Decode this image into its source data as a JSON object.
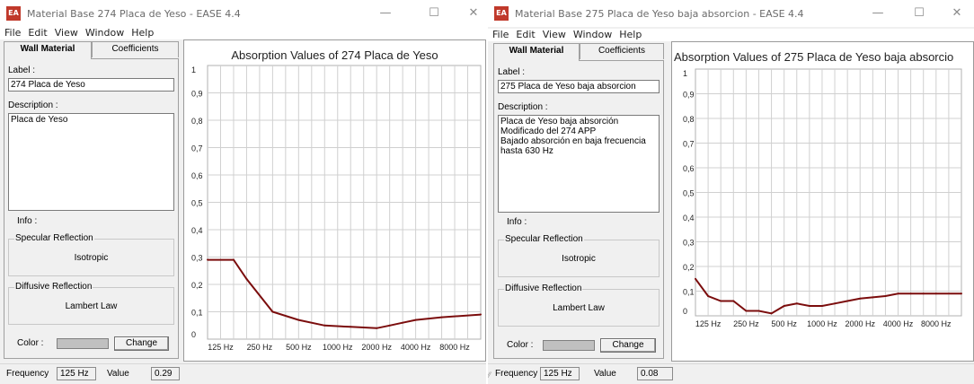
{
  "windows": [
    {
      "title": "Material Base 274 Placa de Yeso - EASE 4.4",
      "icon": "ease-app-icon",
      "menu": [
        "File",
        "Edit",
        "View",
        "Window",
        "Help"
      ],
      "tabs": {
        "active": "Wall Material",
        "inactive": "Coefficients"
      },
      "label_caption": "Label :",
      "label_value": "274 Placa de Yeso",
      "description_caption": "Description :",
      "description_value": "Placa de Yeso",
      "info_caption": "Info :",
      "specular_caption": "Specular Reflection",
      "specular_value": "Isotropic",
      "diffusive_caption": "Diffusive Reflection",
      "diffusive_value": "Lambert Law",
      "color_caption": "Color :",
      "change_label": "Change",
      "status": {
        "frequency_caption": "Frequency",
        "frequency_value": "125 Hz",
        "value_caption": "Value",
        "value": "0.29"
      },
      "chart_data": {
        "type": "line",
        "title": "Absorption Values of 274 Placa de Yeso",
        "xlabel": "",
        "ylabel": "",
        "x_tick_labels": [
          "125 Hz",
          "250 Hz",
          "500 Hz",
          "1000 Hz",
          "2000 Hz",
          "4000 Hz",
          "8000 Hz"
        ],
        "y_tick_labels": [
          "0",
          "0,1",
          "0,2",
          "0,3",
          "0,4",
          "0,5",
          "0,6",
          "0,7",
          "0,8",
          "0,9",
          "1"
        ],
        "ylim": [
          0,
          1
        ],
        "grid": true,
        "line_color": "#7b0d0d",
        "x_third_octave": [
          0,
          2,
          3,
          5,
          7,
          9,
          11,
          13,
          14,
          15,
          16,
          18,
          21
        ],
        "values": [
          0.29,
          0.29,
          0.22,
          0.1,
          0.07,
          0.05,
          0.045,
          0.04,
          0.05,
          0.06,
          0.07,
          0.08,
          0.09
        ],
        "end_value": 0.09
      }
    },
    {
      "title": "Material Base 275 Placa de Yeso baja absorcion - EASE 4.4",
      "icon": "ease-app-icon",
      "menu": [
        "File",
        "Edit",
        "View",
        "Window",
        "Help"
      ],
      "tabs": {
        "active": "Wall Material",
        "inactive": "Coefficients"
      },
      "label_caption": "Label :",
      "label_value": "275 Placa de Yeso baja absorcion",
      "description_caption": "Description :",
      "description_value": "Placa de Yeso baja absorción\nModificado del 274 APP\nBajado absorción en baja frecuencia\nhasta 630 Hz",
      "info_caption": "Info :",
      "specular_caption": "Specular Reflection",
      "specular_value": "Isotropic",
      "diffusive_caption": "Diffusive Reflection",
      "diffusive_value": "Lambert Law",
      "color_caption": "Color :",
      "change_label": "Change",
      "status": {
        "frequency_caption": "Frequency",
        "frequency_value": "125 Hz",
        "value_caption": "Value",
        "value": "0.08"
      },
      "chart_data": {
        "type": "line",
        "title": "Absorption Values of 275 Placa de Yeso baja absorcio",
        "xlabel": "",
        "ylabel": "",
        "x_tick_labels": [
          "125 Hz",
          "250 Hz",
          "500 Hz",
          "1000 Hz",
          "2000 Hz",
          "4000 Hz",
          "8000 Hz"
        ],
        "y_tick_labels": [
          "0",
          "0,1",
          "0,2",
          "0,3",
          "0,4",
          "0,5",
          "0,6",
          "0,7",
          "0,8",
          "0,9",
          "1"
        ],
        "ylim": [
          0,
          1
        ],
        "grid": true,
        "line_color": "#7b0d0d",
        "x_third_octave": [
          0,
          1,
          2,
          3,
          4,
          5,
          6,
          7,
          8,
          9,
          10,
          11,
          12,
          13,
          14,
          15,
          16,
          17,
          18,
          19,
          21
        ],
        "values": [
          0.15,
          0.08,
          0.06,
          0.06,
          0.02,
          0.02,
          0.01,
          0.04,
          0.05,
          0.04,
          0.04,
          0.05,
          0.06,
          0.07,
          0.075,
          0.08,
          0.09,
          0.09,
          0.09,
          0.09,
          0.09
        ],
        "end_value": 0.09
      }
    }
  ]
}
